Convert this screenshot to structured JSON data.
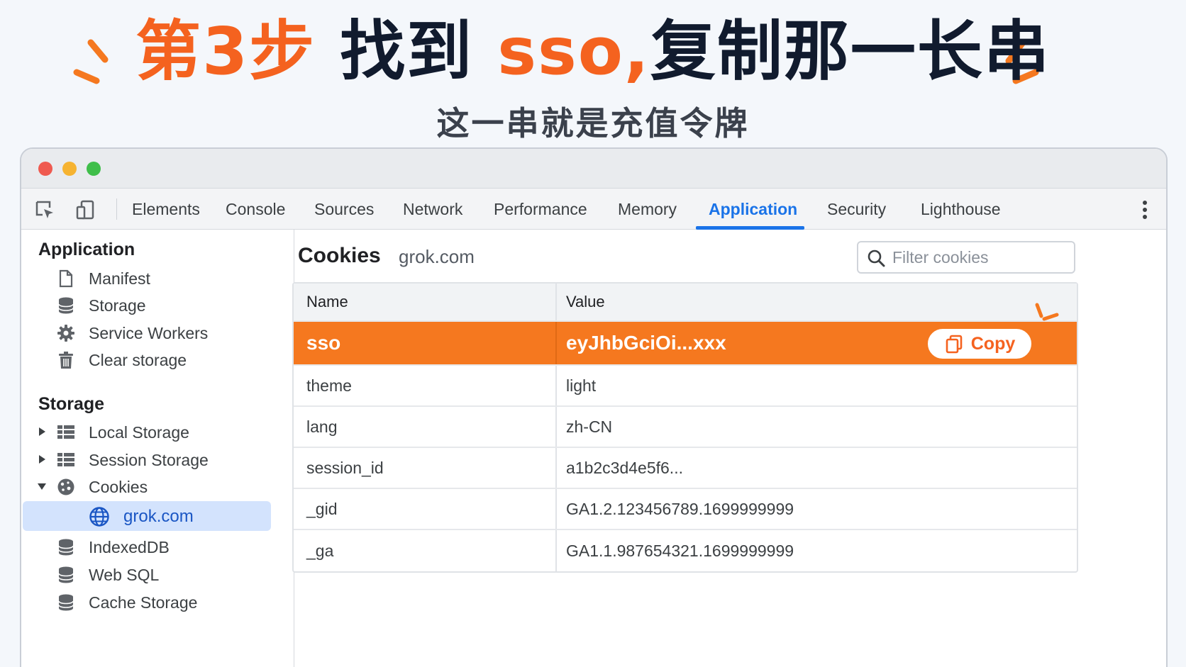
{
  "headline": {
    "step": "第3步",
    "find": "找到",
    "keyword": "sso,",
    "rest": "复制那一长串"
  },
  "subhead": "这一串就是充值令牌",
  "devtools": {
    "tabs": [
      "Elements",
      "Console",
      "Sources",
      "Network",
      "Performance",
      "Memory",
      "Application",
      "Security",
      "Lighthouse"
    ],
    "active_tab": "Application"
  },
  "sidebar": {
    "application_heading": "Application",
    "application_items": [
      {
        "label": "Manifest",
        "icon": "document-icon"
      },
      {
        "label": "Storage",
        "icon": "database-icon"
      },
      {
        "label": "Service Workers",
        "icon": "gear-icon"
      },
      {
        "label": "Clear storage",
        "icon": "trash-icon"
      }
    ],
    "storage_heading": "Storage",
    "storage_items": [
      {
        "label": "Local Storage",
        "icon": "grid-icon",
        "expanded": false
      },
      {
        "label": "Session Storage",
        "icon": "grid-icon",
        "expanded": false
      },
      {
        "label": "Cookies",
        "icon": "cookie-icon",
        "expanded": true
      },
      {
        "label": "grok.com",
        "icon": "globe-icon",
        "selected": true
      },
      {
        "label": "IndexedDB",
        "icon": "database-icon"
      },
      {
        "label": "Web SQL",
        "icon": "database-icon"
      },
      {
        "label": "Cache Storage",
        "icon": "database-icon"
      }
    ]
  },
  "main": {
    "title": "Cookies",
    "domain": "grok.com",
    "filter_placeholder": "Filter cookies",
    "columns": [
      "Name",
      "Value"
    ],
    "rows": [
      {
        "name": "sso",
        "value": "eyJhbGciOi...xxx",
        "highlighted": true
      },
      {
        "name": "theme",
        "value": "light"
      },
      {
        "name": "lang",
        "value": "zh-CN"
      },
      {
        "name": "session_id",
        "value": "a1b2c3d4e5f6..."
      },
      {
        "name": "_gid",
        "value": "GA1.2.123456789.1699999999"
      },
      {
        "name": "_ga",
        "value": "GA1.1.987654321.1699999999"
      }
    ],
    "copy_label": "Copy"
  },
  "colors": {
    "accent_orange": "#f5781f",
    "headline_dark": "#111b2e",
    "chrome_blue": "#1a73e8"
  }
}
